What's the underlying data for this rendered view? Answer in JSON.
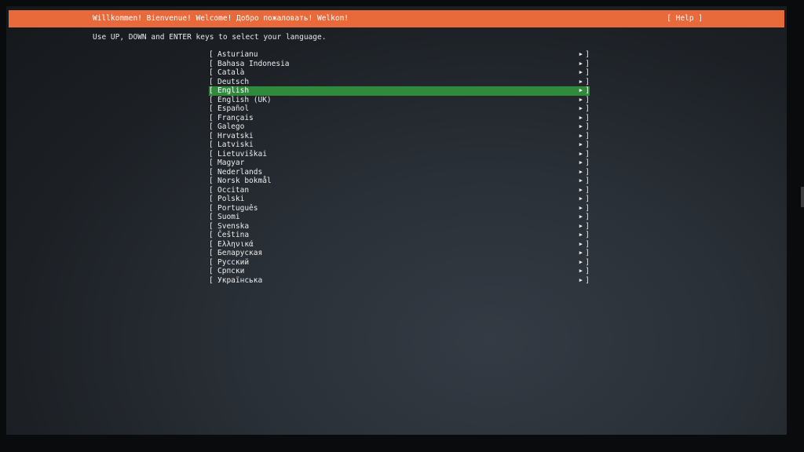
{
  "header": {
    "title": "Willkommen! Bienvenue! Welcome! Добро пожаловать! Welkom!",
    "help_label": "[ Help ]",
    "accent_color": "#e8693a"
  },
  "instructions": "Use UP, DOWN and ENTER keys to select your language.",
  "languages": {
    "selected_color": "#2f8a3b",
    "items": [
      {
        "label": "Asturianu"
      },
      {
        "label": "Bahasa Indonesia"
      },
      {
        "label": "Català"
      },
      {
        "label": "Deutsch"
      },
      {
        "label": "English",
        "selected": true
      },
      {
        "label": "English (UK)"
      },
      {
        "label": "Español"
      },
      {
        "label": "Français"
      },
      {
        "label": "Galego"
      },
      {
        "label": "Hrvatski"
      },
      {
        "label": "Latviski"
      },
      {
        "label": "Lietuviškai"
      },
      {
        "label": "Magyar"
      },
      {
        "label": "Nederlands"
      },
      {
        "label": "Norsk bokmål"
      },
      {
        "label": "Occitan"
      },
      {
        "label": "Polski"
      },
      {
        "label": "Português"
      },
      {
        "label": "Suomi"
      },
      {
        "label": "Svenska"
      },
      {
        "label": "Čeština"
      },
      {
        "label": "Ελληνικά"
      },
      {
        "label": "Беларуская"
      },
      {
        "label": "Русский"
      },
      {
        "label": "Српски"
      },
      {
        "label": "Українська"
      }
    ]
  }
}
